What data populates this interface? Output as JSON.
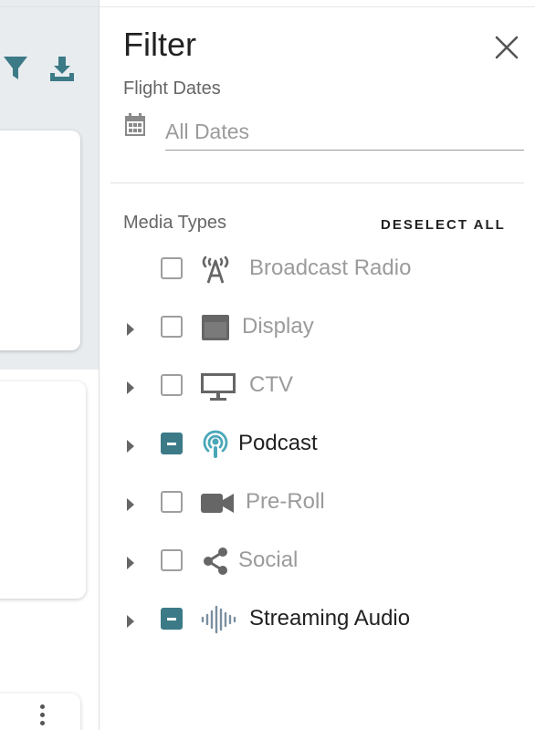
{
  "panel": {
    "title": "Filter",
    "flight_dates_label": "Flight Dates",
    "date_placeholder": "All Dates",
    "media_types_label": "Media Types",
    "deselect_all_label": "DESELECT ALL"
  },
  "media_types": [
    {
      "label": "Broadcast Radio",
      "icon": "broadcast-radio-icon",
      "state": "unchecked",
      "expandable": false
    },
    {
      "label": "Display",
      "icon": "display-icon",
      "state": "unchecked",
      "expandable": true
    },
    {
      "label": "CTV",
      "icon": "tv-monitor-icon",
      "state": "unchecked",
      "expandable": true
    },
    {
      "label": "Podcast",
      "icon": "podcast-icon",
      "state": "indeterminate",
      "expandable": true
    },
    {
      "label": "Pre-Roll",
      "icon": "video-camera-icon",
      "state": "unchecked",
      "expandable": true
    },
    {
      "label": "Social",
      "icon": "share-icon",
      "state": "unchecked",
      "expandable": true
    },
    {
      "label": "Streaming Audio",
      "icon": "audio-waveform-icon",
      "state": "indeterminate",
      "expandable": true
    }
  ],
  "colors": {
    "accent": "#3c7a87",
    "podcast_icon": "#4aa7b8",
    "muted_text": "#9b9b9b",
    "icon_gray": "#666666"
  }
}
